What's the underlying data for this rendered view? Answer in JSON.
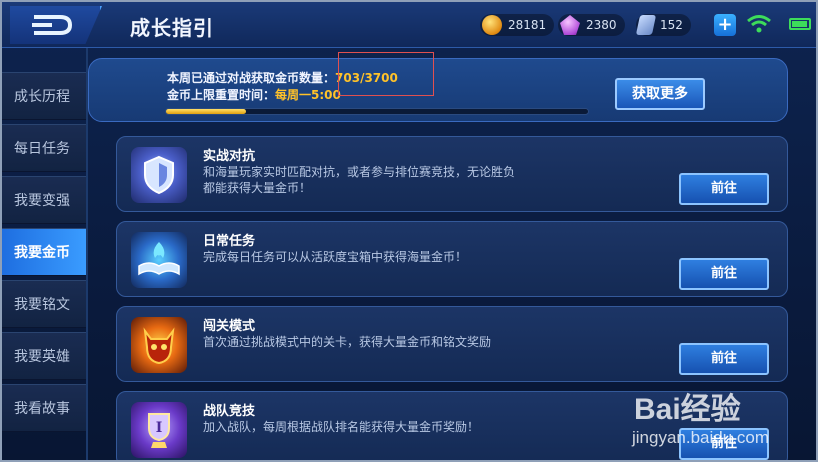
{
  "header": {
    "title": "成长指引",
    "coins": "28181",
    "gems": "2380",
    "tickets": "152",
    "plus": "+"
  },
  "sidebar": {
    "items": [
      {
        "label": "成长历程"
      },
      {
        "label": "每日任务"
      },
      {
        "label": "我要变强"
      },
      {
        "label": "我要金币"
      },
      {
        "label": "我要铭文"
      },
      {
        "label": "我要英雄"
      },
      {
        "label": "我看故事"
      }
    ],
    "active_index": 3
  },
  "summary": {
    "weekly_label": "本周已通过对战获取金币数量：",
    "weekly_value": "703/3700",
    "progress": 0.19,
    "reset_label": "金币上限重置时间：",
    "reset_value": "每周一5:00",
    "more_label": "获取更多"
  },
  "cards": [
    {
      "title": "实战对抗",
      "desc": "和海量玩家实时匹配对抗，或者参与排位赛竞技，无论胜负都能获得大量金币！",
      "button": "前往",
      "icon": "shield-icon"
    },
    {
      "title": "日常任务",
      "desc": "完成每日任务可以从活跃度宝箱中获得海量金币！",
      "button": "前往",
      "icon": "book-icon"
    },
    {
      "title": "闯关模式",
      "desc": "首次通过挑战模式中的关卡，获得大量金币和铭文奖励",
      "button": "前往",
      "icon": "demon-mask-icon"
    },
    {
      "title": "战队竞技",
      "desc": "加入战队，每周根据战队排名能获得大量金币奖励！",
      "button": "前往",
      "icon": "trophy-icon"
    }
  ],
  "watermark": {
    "logo": "Bai经验",
    "url": "jingyan.baidu.com"
  },
  "colors": {
    "accent": "#3a9cff",
    "highlight": "#ffc229",
    "success": "#3ddc5a"
  }
}
